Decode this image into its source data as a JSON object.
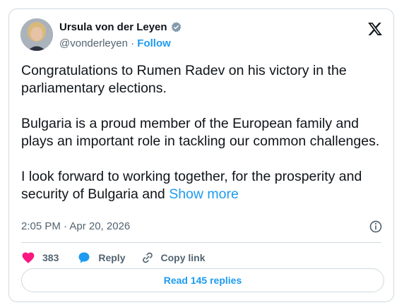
{
  "author": {
    "name": "Ursula von der Leyen",
    "handle": "@vonderleyen",
    "separator": "·",
    "follow_label": "Follow"
  },
  "tweet": {
    "paragraphs": [
      "Congratulations to Rumen Radev on his victory in the parliamentary elections.",
      "Bulgaria is a proud member of the European family and plays an important role in tackling our common challenges."
    ],
    "last_paragraph": "I look forward to working together, for the prosperity and security of Bulgaria and",
    "show_more": "Show more",
    "timestamp": "2:05 PM · Apr 20, 2026"
  },
  "actions": {
    "likes": "383",
    "reply_label": "Reply",
    "copy_link_label": "Copy link"
  },
  "read_replies": "Read 145 replies",
  "colors": {
    "accent": "#1d9bf0",
    "like": "#f91880",
    "text": "#0f1419",
    "muted": "#536471",
    "border": "#cfd9de"
  }
}
